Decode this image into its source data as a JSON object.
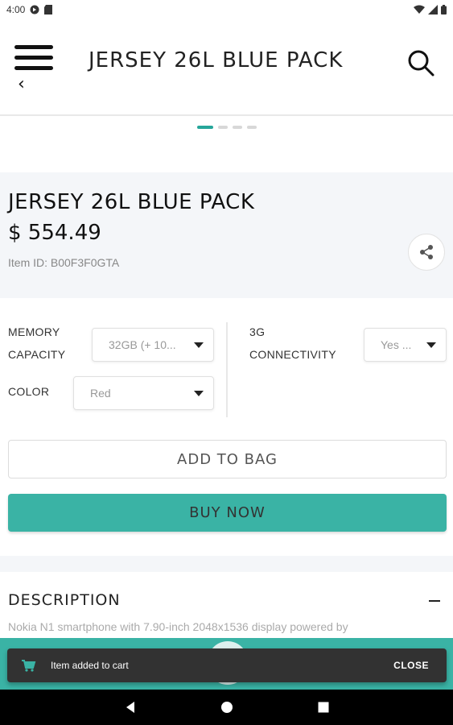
{
  "status_bar": {
    "time": "4:00",
    "icons_left": [
      "app-notification-icon",
      "sd-card-icon"
    ],
    "icons_right": [
      "wifi-icon",
      "signal-icon",
      "battery-icon"
    ]
  },
  "app_bar": {
    "title": "JERSEY 26L BLUE PACK",
    "menu_icon": "hamburger-menu-icon",
    "back_icon": "chevron-left-icon",
    "search_icon": "search-icon"
  },
  "carousel": {
    "pages": 4,
    "active_index": 0,
    "active_color": "#26a69a"
  },
  "product": {
    "title": "JERSEY 26L BLUE PACK",
    "price": "$ 554.49",
    "item_id": "Item ID: B00F3F0GTA",
    "share_icon": "share-icon"
  },
  "options": {
    "memory": {
      "label_line1": "MEMORY",
      "label_line2": "CAPACITY",
      "value": "32GB (+ 10..."
    },
    "connectivity": {
      "label_line1": "3G",
      "label_line2": "CONNECTIVITY",
      "value": "Yes ..."
    },
    "color": {
      "label": "COLOR",
      "value": "Red"
    }
  },
  "actions": {
    "add_to_bag": "ADD TO BAG",
    "buy_now": "BUY NOW",
    "accent": "#3ab3a5"
  },
  "description": {
    "heading": "DESCRIPTION",
    "text": "Nokia N1 smartphone with 7.90-inch 2048x1536 display powered by"
  },
  "snackbar": {
    "message": "Item added to cart",
    "action": "CLOSE",
    "icon": "shopping-cart-icon"
  },
  "nav_bar": {
    "buttons": [
      "back-triangle-icon",
      "home-circle-icon",
      "recents-square-icon"
    ]
  }
}
